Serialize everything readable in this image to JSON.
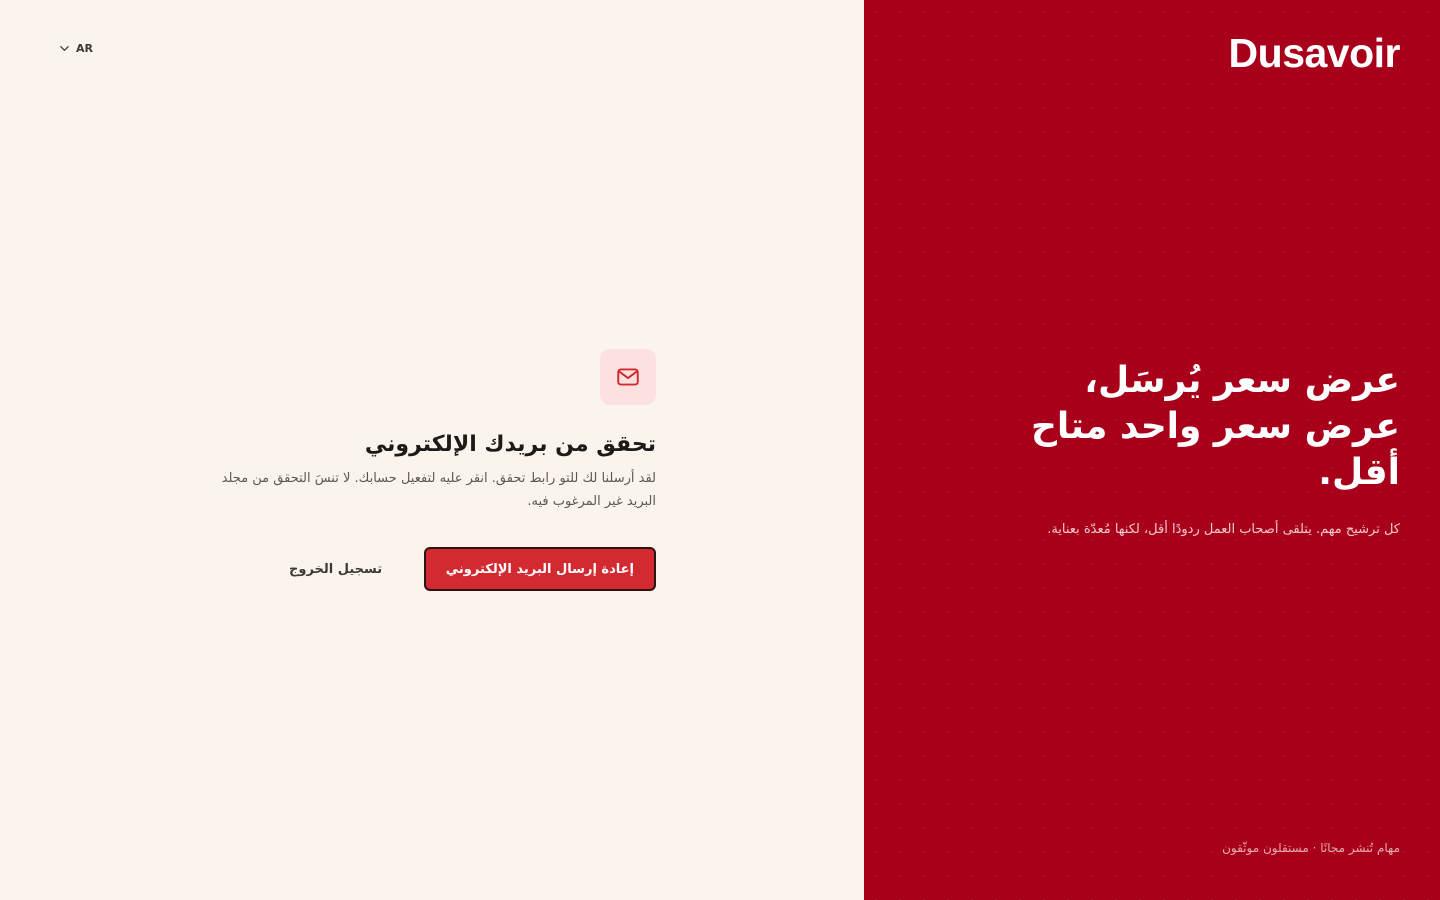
{
  "language": {
    "current": "AR"
  },
  "verify": {
    "icon": "mail-icon",
    "title": "تحقق من بريدك الإلكتروني",
    "description": "لقد أرسلنا لك للتو رابط تحقق. انقر عليه لتفعيل حسابك. لا تنسَ التحقق من مجلد البريد غير المرغوب فيه.",
    "resend_label": "إعادة إرسال البريد الإلكتروني",
    "logout_label": "تسجيل الخروج"
  },
  "brand": {
    "logo_text": "Dusavoir"
  },
  "hero": {
    "title": "عرض سعر يُرسَل، عرض سعر واحد متاح أقل.",
    "subtitle": "كل ترشيح مهم. يتلقى أصحاب العمل ردودًا أقل، لكنها مُعدّة بعناية."
  },
  "footer": {
    "note": "مهام تُنشر مجانًا · مستقلون موثّقون"
  },
  "colors": {
    "brand_red": "#a8001a",
    "button_red": "#d32a32",
    "cream": "#fbf4ec",
    "badge_bg": "#fde1df"
  }
}
